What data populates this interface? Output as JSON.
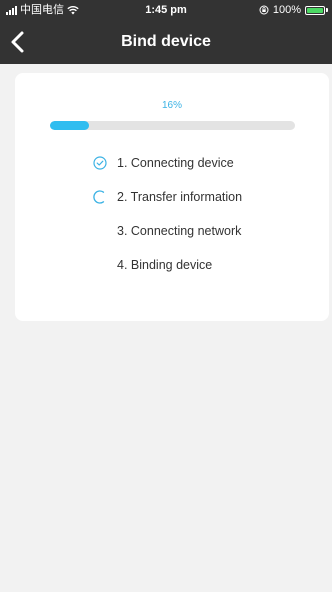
{
  "status_bar": {
    "carrier": "中国电信",
    "time": "1:45 pm",
    "battery_percent": "100%"
  },
  "nav": {
    "title": "Bind device",
    "back_icon": "chevron-left-icon"
  },
  "progress": {
    "label": "16%",
    "value": 0.16,
    "accent_color": "#30bdf0"
  },
  "steps": [
    {
      "label": "1. Connecting device",
      "state": "done",
      "icon": "check-circle-icon"
    },
    {
      "label": "2. Transfer information",
      "state": "in-progress",
      "icon": "spinner-icon"
    },
    {
      "label": "3. Connecting network",
      "state": "pending"
    },
    {
      "label": "4. Binding device",
      "state": "pending"
    }
  ]
}
